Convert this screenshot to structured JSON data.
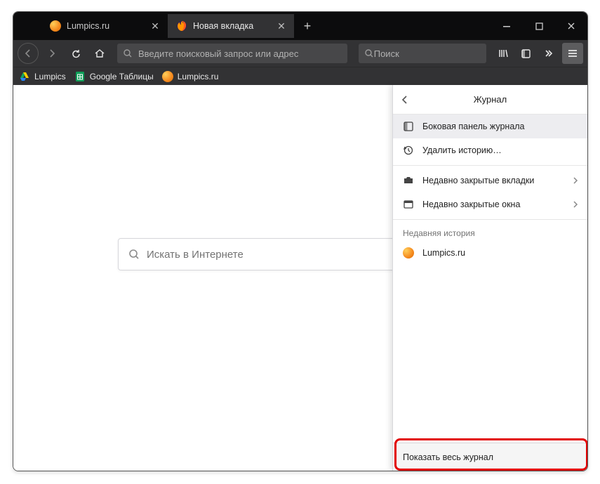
{
  "tabs": [
    {
      "title": "Lumpics.ru",
      "active": false
    },
    {
      "title": "Новая вкладка",
      "active": true
    }
  ],
  "urlbar": {
    "placeholder": "Введите поисковый запрос или адрес"
  },
  "searchbar": {
    "placeholder": "Поиск"
  },
  "bookmarks": [
    {
      "label": "Lumpics"
    },
    {
      "label": "Google Таблицы"
    },
    {
      "label": "Lumpics.ru"
    }
  ],
  "centerSearch": {
    "placeholder": "Искать в Интернете"
  },
  "panel": {
    "title": "Журнал",
    "items": {
      "sidebar": "Боковая панель журнала",
      "clear": "Удалить историю…",
      "recentTabs": "Недавно закрытые вкладки",
      "recentWindows": "Недавно закрытые окна"
    },
    "recentHeader": "Недавняя история",
    "recent": [
      {
        "label": "Lumpics.ru"
      }
    ],
    "footer": "Показать весь журнал"
  }
}
